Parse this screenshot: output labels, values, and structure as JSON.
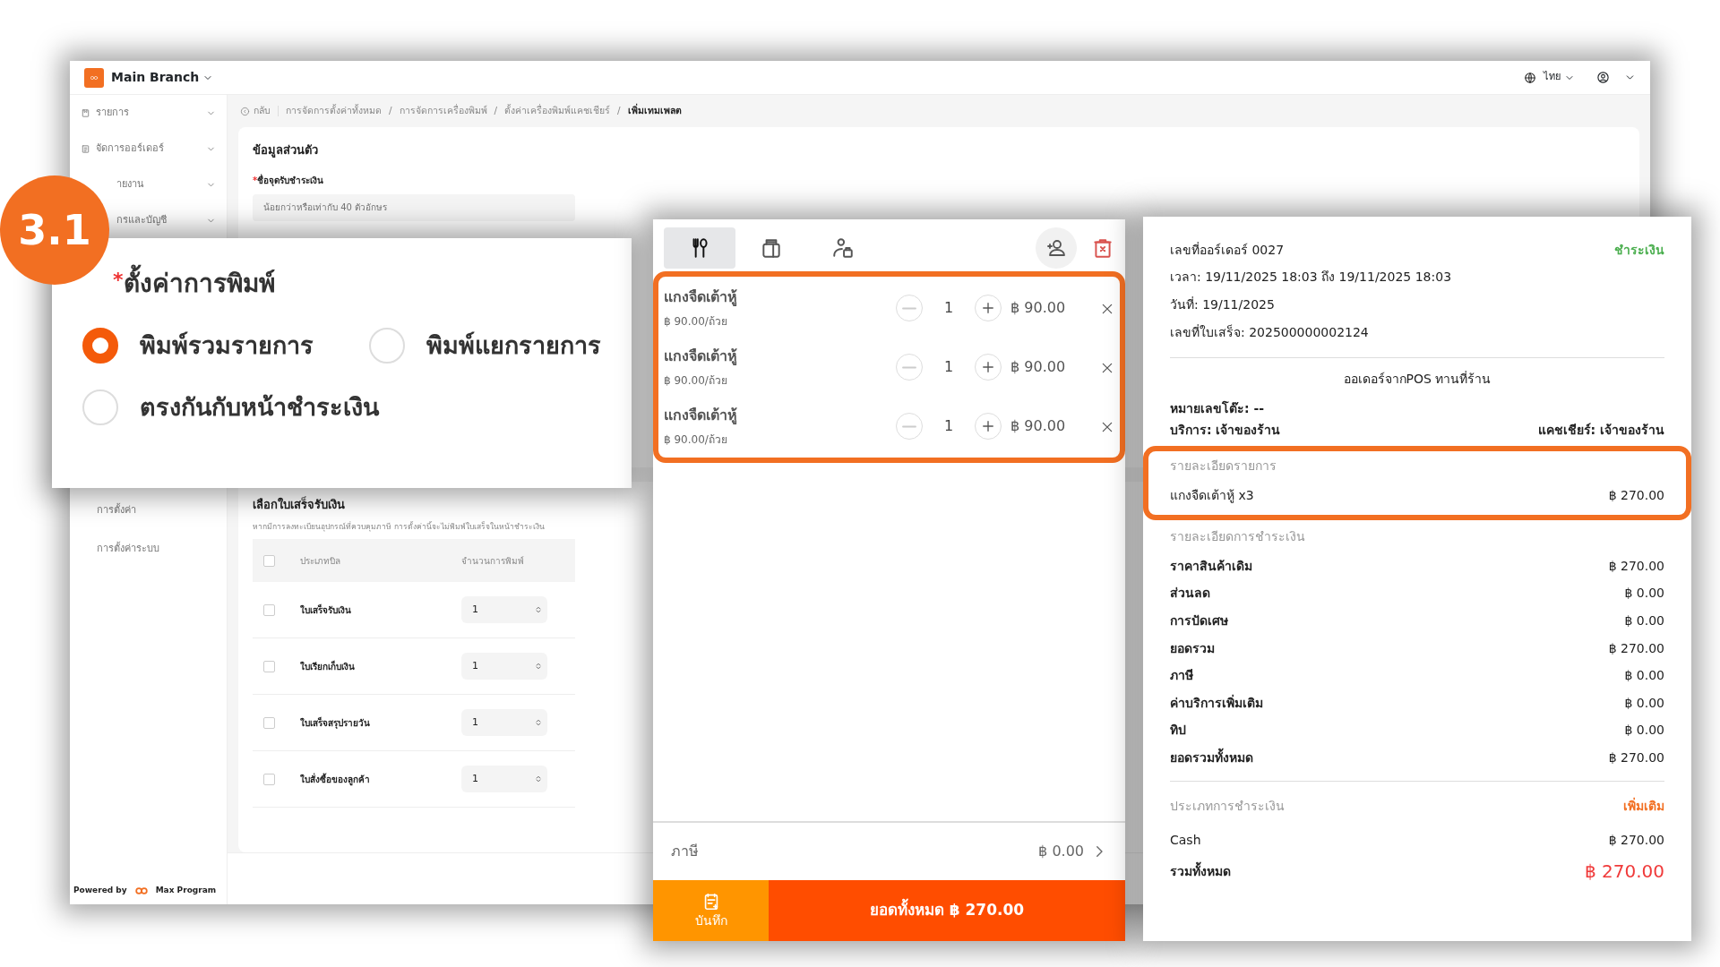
{
  "app": {
    "branch": "Main Branch",
    "language": "ไทย"
  },
  "sidebar": {
    "items": [
      {
        "label": "รายการ",
        "kind": "group"
      },
      {
        "label": "จัดการออร์เดอร์",
        "kind": "group"
      },
      {
        "label": "ายงาน",
        "kind": "group"
      },
      {
        "label": "กรและบัญชี",
        "kind": "group"
      },
      {
        "label": "การตั้งค่า",
        "kind": "link"
      },
      {
        "label": "การตั้งค่าระบบ",
        "kind": "link"
      }
    ],
    "footer": "Powered by",
    "brand": "Max Program"
  },
  "breadcrumb": {
    "back": "กลับ",
    "separator": "/",
    "items": [
      "การจัดการตั้งค่าทั้งหมด",
      "การจัดการเครื่องพิมพ์",
      "ตั้งค่าเครื่องพิมพ์แคชเชียร์",
      "เพิ่มเทมเพลต"
    ]
  },
  "personal": {
    "title": "ข้อมูลส่วนตัว",
    "label": "ชื่อจุดรับชำระเงิน",
    "required_mark": "*",
    "placeholder": "น้อยกว่าหรือเท่ากับ 40 ตัวอักษร"
  },
  "print_settings": {
    "step": "3.1",
    "title": "ตั้งค่าการพิมพ์",
    "required_mark": "*",
    "options": [
      {
        "label": "พิมพ์รวมรายการ",
        "selected": true
      },
      {
        "label": "พิมพ์แยกรายการ",
        "selected": false
      },
      {
        "label": "ตรงกันกับหน้าชำระเงิน",
        "selected": false
      }
    ]
  },
  "receipt_select": {
    "title": "เลือกใบเสร็จรับเงิน",
    "note": "หากมีการลงทะเบียนอุปกรณ์ที่ควบคุมภาษี การตั้งค่านี้จะไม่พิมพ์ใบเสร็จในหน้าชำระเงิน",
    "columns": [
      "ประเภทบิล",
      "จำนวนการพิมพ์"
    ],
    "all_checked": false,
    "rows": [
      {
        "name": "ใบเสร็จรับเงิน",
        "checked": false,
        "copies": "1"
      },
      {
        "name": "ใบเรียกเก็บเงิน",
        "checked": false,
        "copies": "1"
      },
      {
        "name": "ใบเสร็จสรุปรายวัน",
        "checked": false,
        "copies": "1"
      },
      {
        "name": "ใบสั่งซื้อของลูกค้า",
        "checked": false,
        "copies": "1"
      }
    ]
  },
  "pos": {
    "tabs": [
      {
        "kind": "dine-in",
        "selected": true
      },
      {
        "kind": "takeaway",
        "selected": false
      },
      {
        "kind": "pickup",
        "selected": false
      }
    ],
    "items": [
      {
        "name": "แกงจืดเต้าหู้",
        "unit_price": "฿ 90.00/ถ้วย",
        "qty": "1",
        "total": "฿ 90.00"
      },
      {
        "name": "แกงจืดเต้าหู้",
        "unit_price": "฿ 90.00/ถ้วย",
        "qty": "1",
        "total": "฿ 90.00"
      },
      {
        "name": "แกงจืดเต้าหู้",
        "unit_price": "฿ 90.00/ถ้วย",
        "qty": "1",
        "total": "฿ 90.00"
      }
    ],
    "tax_label": "ภาษี",
    "tax": "฿ 0.00",
    "save": "บันทึก",
    "total_button": "ยอดทั้งหมด ฿ 270.00"
  },
  "receipt": {
    "order_no": "เลขที่ออร์เดอร์ 0027",
    "status": "ชำระเงิน",
    "lines": [
      "เวลา: 19/11/2025 18:03 ถึง 19/11/2025 18:03",
      "วันที่: 19/11/2025",
      "เลขที่ใบเสร็จ: 202500000002124"
    ],
    "source": "ออเดอร์จากPOS ทานที่ร้าน",
    "table": "หมายเลขโต๊ะ: --",
    "service": "บริการ: เจ้าของร้าน",
    "cashier": "แคชเชียร์: เจ้าของร้าน",
    "items_title": "รายละเอียดรายการ",
    "items": [
      {
        "name": "แกงจืดเต้าหู้ x3",
        "amount": "฿ 270.00"
      }
    ],
    "payment_title": "รายละเอียดการชำระเงิน",
    "payment_rows": [
      {
        "label": "ราคาสินค้าเดิม",
        "value": "฿ 270.00"
      },
      {
        "label": "ส่วนลด",
        "value": "฿ 0.00"
      },
      {
        "label": "การปัดเศษ",
        "value": "฿ 0.00"
      },
      {
        "label": "ยอดรวม",
        "value": "฿ 270.00"
      },
      {
        "label": "ภาษี",
        "value": "฿ 0.00"
      },
      {
        "label": "ค่าบริการเพิ่มเติม",
        "value": "฿ 0.00"
      },
      {
        "label": "ทิป",
        "value": "฿ 0.00"
      },
      {
        "label": "ยอดรวมทั้งหมด",
        "value": "฿ 270.00"
      }
    ],
    "types_title": "ประเภทการชำระเงิน",
    "add": "เพิ่มเติม",
    "methods": [
      {
        "label": "Cash",
        "value": "฿ 270.00"
      }
    ],
    "grand_label": "รวมทั้งหมด",
    "grand": "฿ 270.00"
  }
}
